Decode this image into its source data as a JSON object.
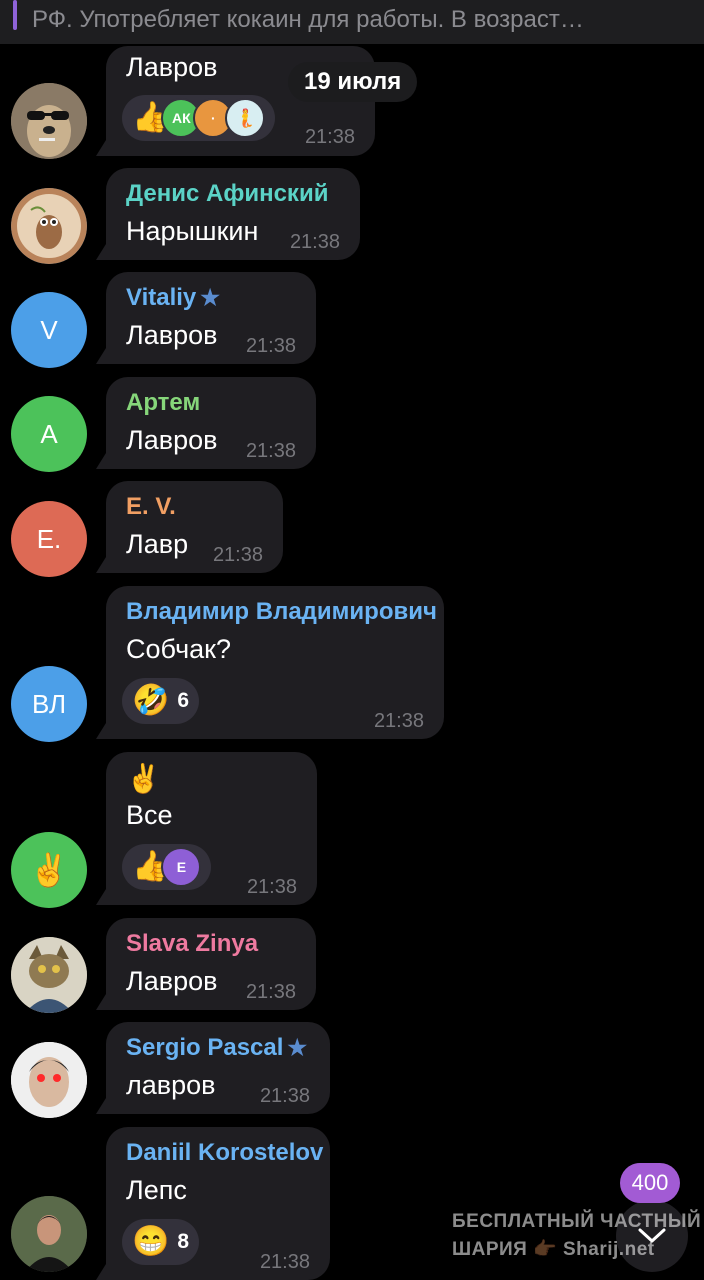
{
  "pinned": {
    "text": "РФ. Употребляет кокаин для работы.  В возраст…"
  },
  "date_pill": "19 июля",
  "messages": [
    {
      "sender": "",
      "text": "Лавров",
      "time": "21:38",
      "reaction": {
        "emoji": "👍",
        "reactors": [
          "АК",
          "·",
          "🧜"
        ]
      }
    },
    {
      "sender": "Денис Афинский",
      "sender_color": "#5bd3c7",
      "text": "Нарышкин",
      "time": "21:38"
    },
    {
      "sender": "Vitaliy",
      "sender_color": "#6ab3f3",
      "starred": true,
      "avatar_letter": "V",
      "text": "Лавров",
      "time": "21:38"
    },
    {
      "sender": "Артем",
      "sender_color": "#86d67a",
      "avatar_letter": "А",
      "text": "Лавров",
      "time": "21:38"
    },
    {
      "sender": "E. V.",
      "sender_color": "#f19f63",
      "avatar_letter": "E.",
      "text": "Лавр",
      "time": "21:38"
    },
    {
      "sender": "Владимир Владимирович",
      "sender_color": "#6ab3f3",
      "avatar_letter": "ВЛ",
      "text": "Собчак?",
      "time": "21:38",
      "reaction": {
        "emoji": "🤣",
        "count": "6"
      }
    },
    {
      "sender": "",
      "avatar_letter": "✌️",
      "emoji_line": "✌️",
      "text": "Все",
      "time": "21:38",
      "reaction": {
        "emoji": "👍",
        "reactors": [
          "E"
        ]
      }
    },
    {
      "sender": "Slava Zinya",
      "sender_color": "#ee7aa0",
      "text": "Лавров",
      "time": "21:38"
    },
    {
      "sender": "Sergio Pascal",
      "sender_color": "#6ab3f3",
      "starred": true,
      "text": "лавров",
      "time": "21:38"
    },
    {
      "sender": "Daniil Korostelov",
      "sender_color": "#6ab3f3",
      "text": "Лепс",
      "time": "21:38",
      "reaction": {
        "emoji": "😁",
        "count": "8"
      }
    }
  ],
  "unread_count": "400",
  "watermark": {
    "line1": "БЕСПЛАТНЫЙ ЧАСТНЫЙ",
    "line2": "ШАРИЯ 👉🏾 Sharij.net"
  },
  "colors": {
    "bubble": "#1f1e22",
    "avatar_blue": "#4c9fe8",
    "avatar_green": "#4cc25a",
    "avatar_red": "#dd6a55",
    "unread_badge": "#a25bd4"
  },
  "icons": {
    "star": "star-icon",
    "scroll_down": "chevron-down-icon"
  }
}
